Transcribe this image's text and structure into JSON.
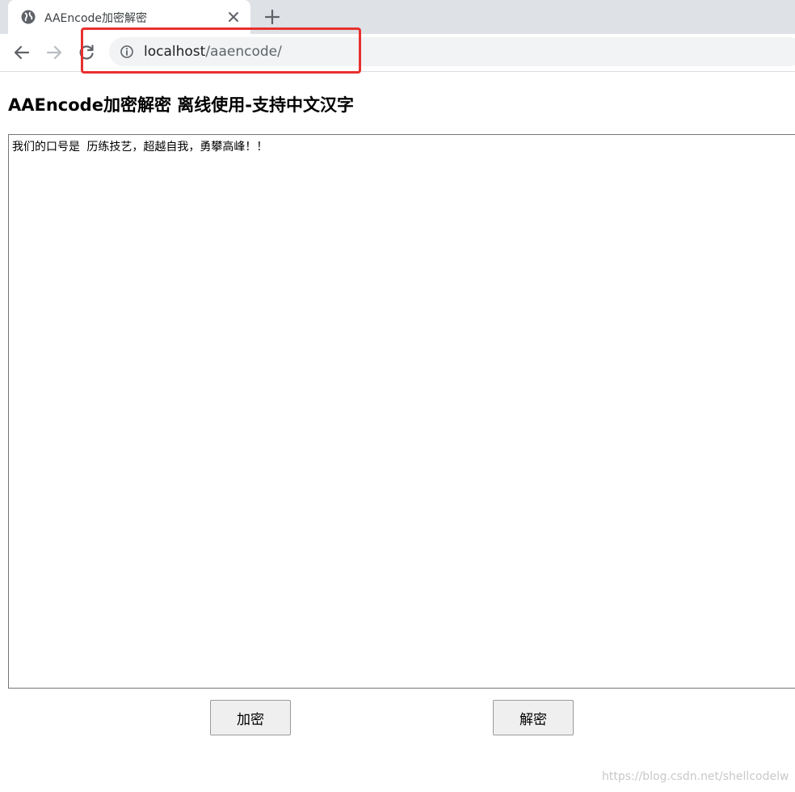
{
  "browser": {
    "tab": {
      "title": "AAEncode加密解密",
      "favicon": "globe-icon",
      "close_icon": "close-icon"
    },
    "new_tab_icon": "plus-icon",
    "toolbar": {
      "back_icon": "arrow-left-icon",
      "forward_icon": "arrow-right-icon",
      "reload_icon": "reload-icon",
      "info_icon": "info-icon"
    },
    "address": {
      "host": "localhost",
      "path": "/aaencode/"
    },
    "highlight_color": "#e8302f"
  },
  "page": {
    "title": "AAEncode加密解密 离线使用-支持中文汉字",
    "textarea_value": "我们的口号是 历练技艺，超越自我，勇攀高峰！！",
    "buttons": {
      "encrypt": "加密",
      "decrypt": "解密"
    }
  },
  "watermark": "https://blog.csdn.net/shellcodelw"
}
